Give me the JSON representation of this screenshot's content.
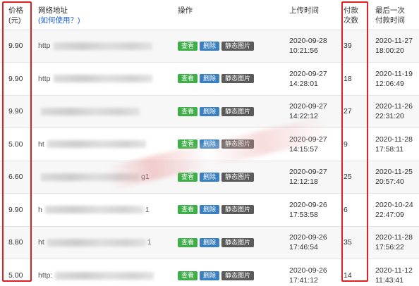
{
  "table": {
    "headers": {
      "price_line1": "价格",
      "price_line2": "(元)",
      "url_line1": "网络地址",
      "url_help": "(如何使用？)",
      "ops": "操作",
      "upload_time": "上传时间",
      "pay_count_line1": "付款",
      "pay_count_line2": "次数",
      "last_pay_line1": "最后一次",
      "last_pay_line2": "付款时间"
    },
    "buttons": {
      "view": "查看",
      "delete": "删除",
      "static": "静态图片"
    },
    "rows": [
      {
        "price": "9.90",
        "url_prefix": "http",
        "url_suffix": "",
        "upload_date": "2020-09-28",
        "upload_time": "10:21:56",
        "pay_count": "39",
        "last_date": "2020-11-27",
        "last_time": "18:00:20"
      },
      {
        "price": "9.90",
        "url_prefix": "http",
        "url_suffix": "",
        "upload_date": "2020-09-27",
        "upload_time": "14:28:01",
        "pay_count": "18",
        "last_date": "2020-11-19",
        "last_time": "12:06:49"
      },
      {
        "price": "9.90",
        "url_prefix": "",
        "url_suffix": "",
        "upload_date": "2020-09-27",
        "upload_time": "14:22:12",
        "pay_count": "27",
        "last_date": "2020-11-26",
        "last_time": "22:31:20"
      },
      {
        "price": "5.00",
        "url_prefix": "ht",
        "url_suffix": "",
        "upload_date": "2020-09-27",
        "upload_time": "14:15:57",
        "pay_count": "9",
        "last_date": "2020-11-28",
        "last_time": "17:58:11"
      },
      {
        "price": "6.60",
        "url_prefix": "",
        "url_suffix": "g1",
        "upload_date": "2020-09-27",
        "upload_time": "12:12:18",
        "pay_count": "25",
        "last_date": "2020-11-25",
        "last_time": "20:57:40"
      },
      {
        "price": "9.90",
        "url_prefix": "h",
        "url_suffix": "1",
        "upload_date": "2020-09-26",
        "upload_time": "17:53:58",
        "pay_count": "6",
        "last_date": "2020-10-24",
        "last_time": "22:47:09"
      },
      {
        "price": "8.80",
        "url_prefix": "ht",
        "url_suffix": "1",
        "upload_date": "2020-09-26",
        "upload_time": "17:46:54",
        "pay_count": "35",
        "last_date": "2020-11-28",
        "last_time": "17:56:22"
      },
      {
        "price": "5.00",
        "url_prefix": "http:",
        "url_suffix": "",
        "upload_date": "2020-09-26",
        "upload_time": "17:41:12",
        "pay_count": "14",
        "last_date": "2020-11-12",
        "last_time": "11:43:41"
      }
    ]
  },
  "colors": {
    "view_button": "#3fae49",
    "delete_button": "#3a7fbf",
    "static_button": "#5a5a5a",
    "highlight_border": "#e02020",
    "help_link": "#1a5fd0"
  }
}
